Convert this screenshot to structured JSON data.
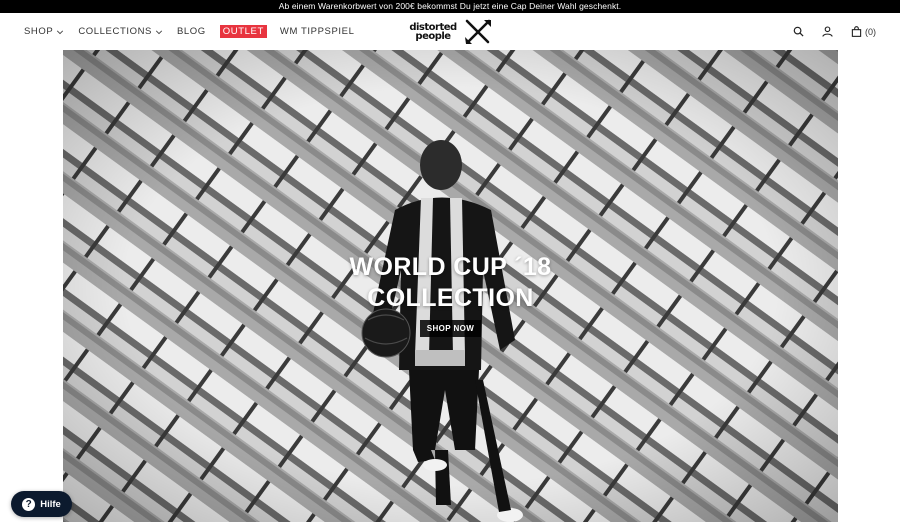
{
  "announcement": "Ab einem Warenkorbwert von 200€ bekommst Du jetzt eine Cap Deiner Wahl geschenkt.",
  "nav": {
    "items": [
      {
        "label": "SHOP"
      },
      {
        "label": "COLLECTIONS"
      },
      {
        "label": "BLOG"
      },
      {
        "label": "OUTLET"
      },
      {
        "label": "WM TIPPSPIEL"
      }
    ],
    "outlet_color": "#e8343f"
  },
  "logo": {
    "line1": "distorted",
    "line2": "people"
  },
  "tools": {
    "search_icon": "search-icon",
    "account_icon": "user-icon",
    "cart_icon": "bag-icon",
    "cart_count": "(0)"
  },
  "hero": {
    "title_line1": "WORLD CUP ´18",
    "title_line2": "COLLECTION",
    "cta": "SHOP NOW"
  },
  "help": {
    "label": "Hilfe",
    "icon": "question-icon",
    "color": "#0c1a2e"
  }
}
